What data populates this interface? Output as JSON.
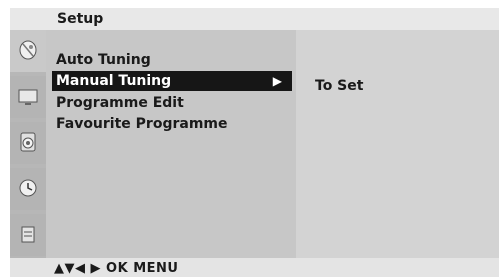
{
  "title": "Setup",
  "menu": {
    "items": [
      {
        "label": "Auto Tuning"
      },
      {
        "label": "Manual Tuning",
        "submenu_arrow": "▶"
      },
      {
        "label": "Programme Edit"
      },
      {
        "label": "Favourite Programme"
      }
    ],
    "selected_index": 1
  },
  "submenu": {
    "text": "To Set"
  },
  "footer": {
    "hint": "▲▼◀ ▶ OK  MENU"
  },
  "icons": [
    "satellite-dish-icon",
    "tv-screen-icon",
    "speaker-icon",
    "clock-icon",
    "lock-icon"
  ]
}
